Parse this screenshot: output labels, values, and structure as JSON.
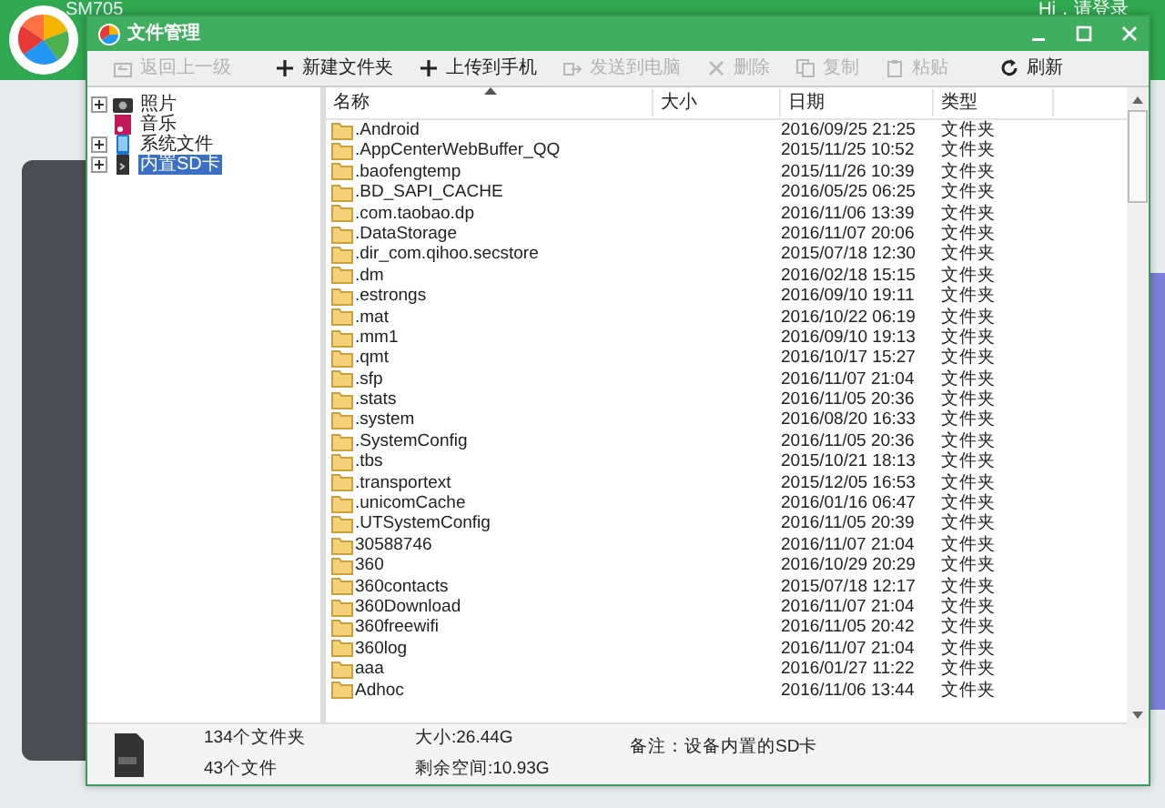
{
  "app": {
    "device_name": "SM705",
    "greeting": "Hi，请登录"
  },
  "window": {
    "title": "文件管理"
  },
  "toolbar": [
    {
      "label": "返回上一级",
      "disabled": true
    },
    {
      "label": "新建文件夹",
      "disabled": false
    },
    {
      "label": "上传到手机",
      "disabled": false
    },
    {
      "label": "发送到电脑",
      "disabled": true
    },
    {
      "label": "删除",
      "disabled": true
    },
    {
      "label": "复制",
      "disabled": true
    },
    {
      "label": "粘贴",
      "disabled": true
    },
    {
      "label": "刷新",
      "disabled": false
    }
  ],
  "tree": [
    {
      "label": "照片",
      "expandable": true,
      "selected": false
    },
    {
      "label": "音乐",
      "expandable": false,
      "selected": false
    },
    {
      "label": "系统文件",
      "expandable": true,
      "selected": false
    },
    {
      "label": "内置SD卡",
      "expandable": true,
      "selected": true
    }
  ],
  "table": {
    "columns": [
      "名称",
      "大小",
      "日期",
      "类型"
    ],
    "rows": [
      {
        "name": ".Android",
        "date": "2016/09/25 21:25",
        "type": "文件夹"
      },
      {
        "name": ".AppCenterWebBuffer_QQ",
        "date": "2015/11/25 10:52",
        "type": "文件夹"
      },
      {
        "name": ".baofengtemp",
        "date": "2015/11/26 10:39",
        "type": "文件夹"
      },
      {
        "name": ".BD_SAPI_CACHE",
        "date": "2016/05/25 06:25",
        "type": "文件夹"
      },
      {
        "name": ".com.taobao.dp",
        "date": "2016/11/06 13:39",
        "type": "文件夹"
      },
      {
        "name": ".DataStorage",
        "date": "2016/11/07 20:06",
        "type": "文件夹"
      },
      {
        "name": ".dir_com.qihoo.secstore",
        "date": "2015/07/18 12:30",
        "type": "文件夹"
      },
      {
        "name": ".dm",
        "date": "2016/02/18 15:15",
        "type": "文件夹"
      },
      {
        "name": ".estrongs",
        "date": "2016/09/10 19:11",
        "type": "文件夹"
      },
      {
        "name": ".mat",
        "date": "2016/10/22 06:19",
        "type": "文件夹"
      },
      {
        "name": ".mm1",
        "date": "2016/09/10 19:13",
        "type": "文件夹"
      },
      {
        "name": ".qmt",
        "date": "2016/10/17 15:27",
        "type": "文件夹"
      },
      {
        "name": ".sfp",
        "date": "2016/11/07 21:04",
        "type": "文件夹"
      },
      {
        "name": ".stats",
        "date": "2016/11/05 20:36",
        "type": "文件夹"
      },
      {
        "name": ".system",
        "date": "2016/08/20 16:33",
        "type": "文件夹"
      },
      {
        "name": ".SystemConfig",
        "date": "2016/11/05 20:36",
        "type": "文件夹"
      },
      {
        "name": ".tbs",
        "date": "2015/10/21 18:13",
        "type": "文件夹"
      },
      {
        "name": ".transportext",
        "date": "2015/12/05 16:53",
        "type": "文件夹"
      },
      {
        "name": ".unicomCache",
        "date": "2016/01/16 06:47",
        "type": "文件夹"
      },
      {
        "name": ".UTSystemConfig",
        "date": "2016/11/05 20:39",
        "type": "文件夹"
      },
      {
        "name": "30588746",
        "date": "2016/11/07 21:04",
        "type": "文件夹"
      },
      {
        "name": "360",
        "date": "2016/10/29 20:29",
        "type": "文件夹"
      },
      {
        "name": "360contacts",
        "date": "2015/07/18 12:17",
        "type": "文件夹"
      },
      {
        "name": "360Download",
        "date": "2016/11/07 21:04",
        "type": "文件夹"
      },
      {
        "name": "360freewifi",
        "date": "2016/11/05 20:42",
        "type": "文件夹"
      },
      {
        "name": "360log",
        "date": "2016/11/07 21:04",
        "type": "文件夹"
      },
      {
        "name": "aaa",
        "date": "2016/01/27 11:22",
        "type": "文件夹"
      },
      {
        "name": "Adhoc",
        "date": "2016/11/06 13:44",
        "type": "文件夹"
      }
    ]
  },
  "status_bar": {
    "folders": "134个文件夹",
    "files": "43个文件",
    "size": "大小:26.44G",
    "free": "剩余空间:10.93G",
    "note": "备注：设备内置的SD卡"
  }
}
